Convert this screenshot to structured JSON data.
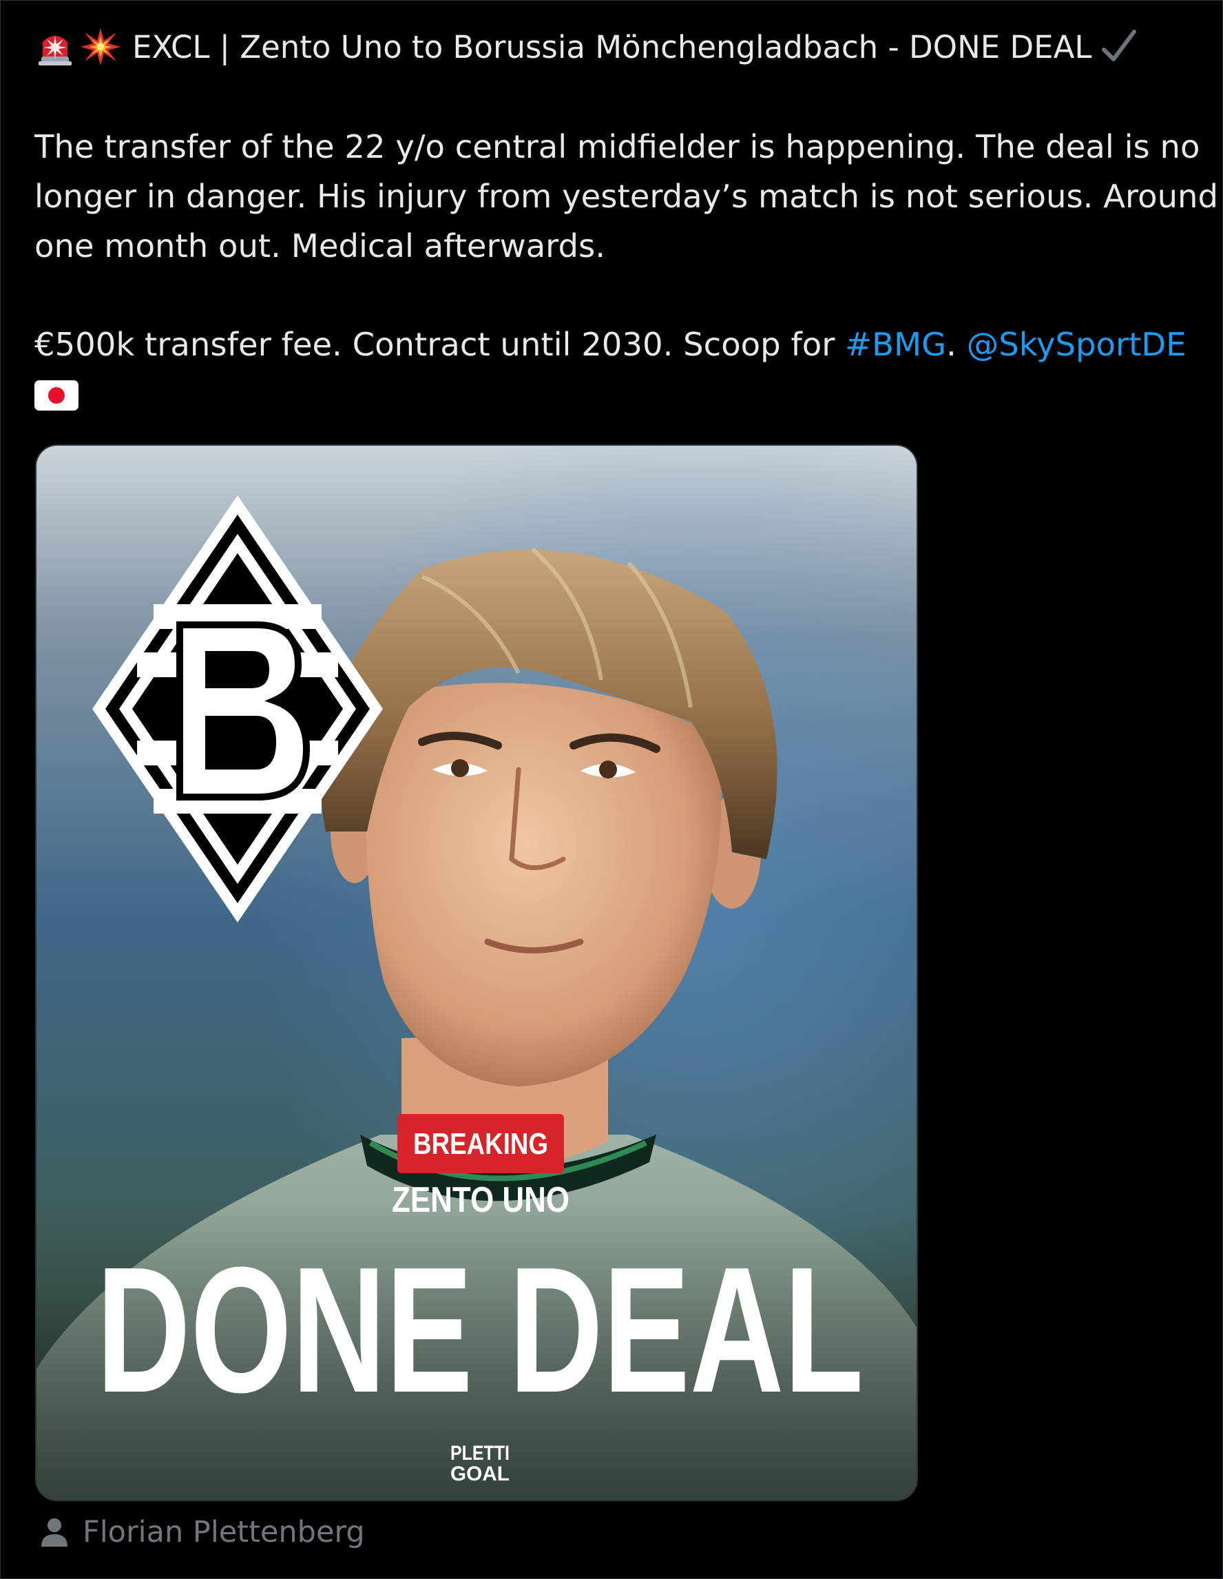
{
  "post": {
    "headline": "EXCL | Zento Uno to Borussia Mönchengladbach - DONE DEAL",
    "body_line1": "The transfer of the 22 y/o central midfielder is happening. The deal is no",
    "body_line2": "longer in danger. His injury from yesterday’s match is not serious. Around",
    "body_line3": "one month out. Medical afterwards.",
    "body2_text": "€500k transfer fee. Contract until 2030. Scoop for ",
    "hashtag": "#BMG",
    "separator": ".",
    "mention": "@SkySportDE"
  },
  "graphic": {
    "badge": "BREAKING",
    "player": "ZENTO UNO",
    "headline": "DONE DEAL",
    "watermark_line1": "PLETTI",
    "watermark_line2": "GOAL",
    "crest_letter": "B"
  },
  "attribution": {
    "name": "Florian Plettenberg",
    "icon": "person-icon"
  },
  "colors": {
    "background": "#000000",
    "text": "#e7e9ea",
    "link": "#1d9bf0",
    "muted": "#71767b",
    "breaking_red": "#d7232a",
    "flag_red": "#e8112d"
  }
}
